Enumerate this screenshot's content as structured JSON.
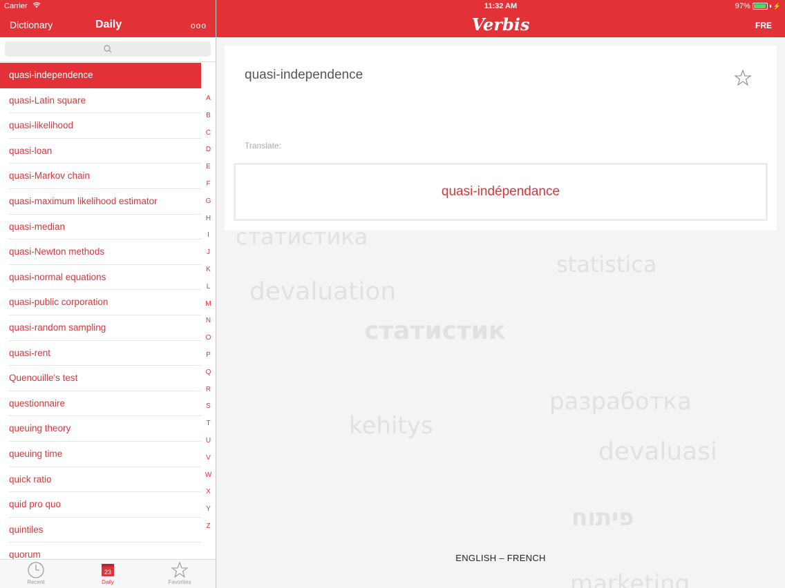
{
  "status": {
    "carrier": "Carrier",
    "time": "11:32 AM",
    "battery": "97%"
  },
  "nav": {
    "dictionary": "Dictionary",
    "daily": "Daily",
    "more": "ooo"
  },
  "header": {
    "title": "Verbis",
    "lang_code": "FRE"
  },
  "search": {
    "placeholder": ""
  },
  "list": {
    "items": [
      "quasi-independence",
      "quasi-Latin square",
      "quasi-likelihood",
      "quasi-loan",
      "quasi-Markov chain",
      "quasi-maximum likelihood estimator",
      "quasi-median",
      "quasi-Newton methods",
      "quasi-normal equations",
      "quasi-public corporation",
      "quasi-random sampling",
      "quasi-rent",
      "Quenouille's test",
      "questionnaire",
      "queuing theory",
      "queuing time",
      "quick ratio",
      "quid pro quo",
      "quintiles",
      "quorum"
    ],
    "selected_index": 0
  },
  "alphabet": [
    "A",
    "B",
    "C",
    "D",
    "E",
    "F",
    "G",
    "H",
    "I",
    "J",
    "K",
    "L",
    "M",
    "N",
    "O",
    "P",
    "Q",
    "R",
    "S",
    "T",
    "U",
    "V",
    "W",
    "X",
    "Y",
    "Z"
  ],
  "tabs": {
    "recent": "Recent",
    "daily": "Daily",
    "daily_day": "23",
    "favorites": "Favorites"
  },
  "entry": {
    "term": "quasi-independence",
    "translate_label": "Translate:",
    "translation": "quasi-indépendance"
  },
  "language_pair": "ENGLISH – FRENCH",
  "background_words": [
    "статистика",
    "statistica",
    "devaluation",
    "статистик",
    "kehitys",
    "разработка",
    "devaluasi",
    "פיתוח",
    "marketing"
  ],
  "colors": {
    "accent": "#e23238",
    "accent_text": "#d9353a",
    "battery": "#4cd964"
  }
}
